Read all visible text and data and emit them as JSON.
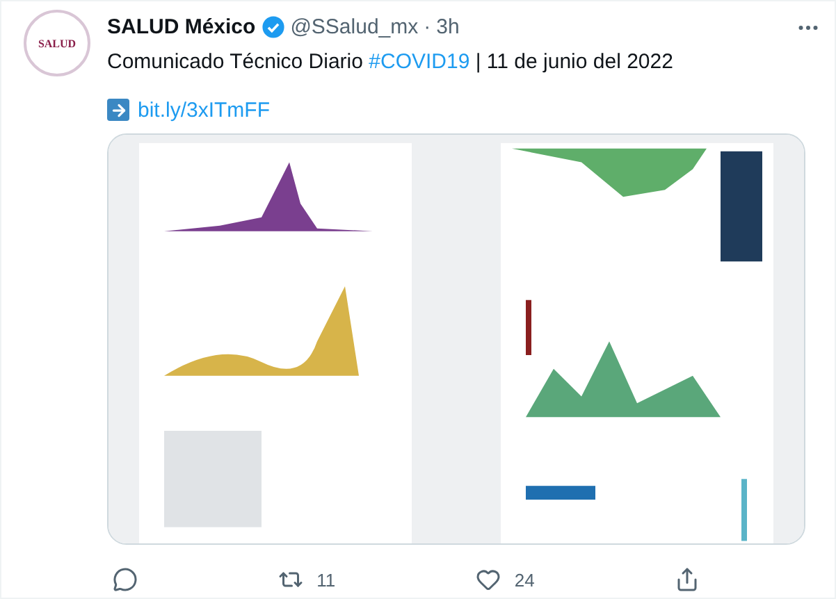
{
  "tweet": {
    "avatar_text": "SALUD",
    "author": "SALUD México",
    "verified": true,
    "handle": "@SSalud_mx",
    "separator": "·",
    "time": "3h",
    "text": [
      {
        "kind": "plain",
        "text": "Comunicado Técnico Diario "
      },
      {
        "kind": "hashtag",
        "text": "#COVID19"
      },
      {
        "kind": "plain",
        "text": " | 11 de junio del 2022"
      }
    ],
    "link": "bit.ly/3xITmFF"
  },
  "actions": [
    {
      "kind": "reply"
    },
    {
      "kind": "retweet",
      "count": "11"
    },
    {
      "kind": "like",
      "count": "24"
    },
    {
      "kind": "share"
    }
  ]
}
